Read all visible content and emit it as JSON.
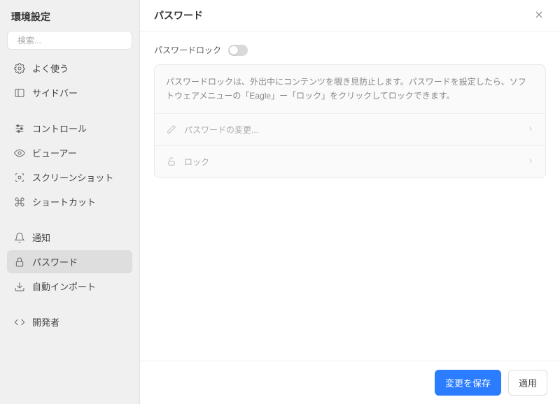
{
  "sidebar": {
    "title": "環境設定",
    "search_placeholder": "検索...",
    "items": [
      {
        "label": "よく使う"
      },
      {
        "label": "サイドバー"
      },
      {
        "label": "コントロール"
      },
      {
        "label": "ビューアー"
      },
      {
        "label": "スクリーンショット"
      },
      {
        "label": "ショートカット"
      },
      {
        "label": "通知"
      },
      {
        "label": "パスワード"
      },
      {
        "label": "自動インポート"
      },
      {
        "label": "開発者"
      }
    ]
  },
  "main": {
    "title": "パスワード",
    "toggle_label": "パスワードロック",
    "description": "パスワードロックは、外出中にコンテンツを覗き見防止します。パスワードを設定したら、ソフトウェアメニューの「Eagle」ー「ロック」をクリックしてロックできます。",
    "change_password": "パスワードの変更...",
    "lock": "ロック"
  },
  "footer": {
    "save": "変更を保存",
    "apply": "適用"
  }
}
